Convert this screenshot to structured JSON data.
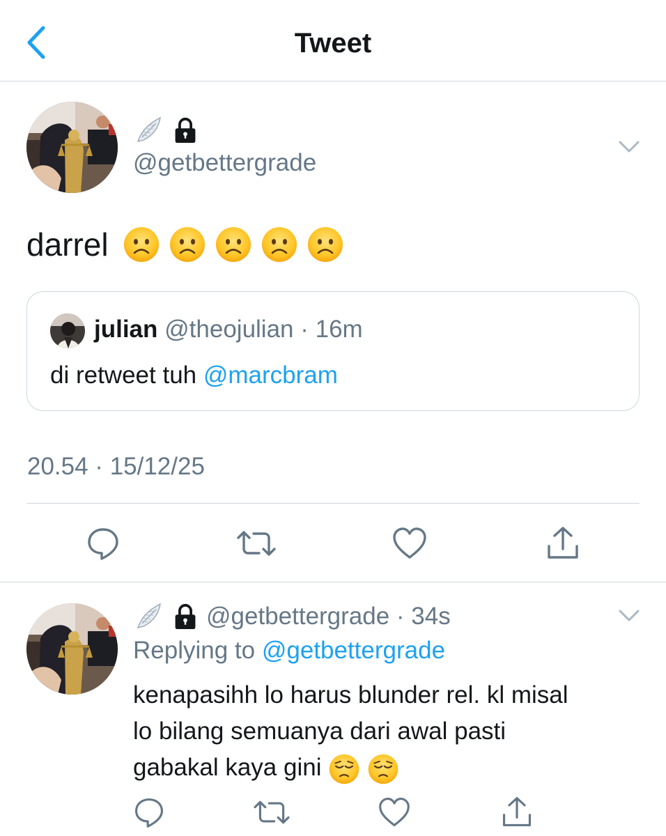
{
  "header": {
    "title": "Tweet"
  },
  "tweet": {
    "handle": "@getbettergrade",
    "text": "darrel",
    "sad_emoji_count": 5,
    "timestamp": "20.54 · 15/12/25",
    "quote": {
      "name": "julian",
      "meta": "@theojulian · 16m",
      "text_prefix": "di retweet tuh ",
      "mention": "@marcbram"
    }
  },
  "reply": {
    "handle_time": "@getbettergrade · 34s",
    "replying_label": "Replying to",
    "replying_to": "@getbettergrade",
    "lines": [
      "kenapasihh lo harus blunder rel. kl misal",
      "lo bilang semuanya dari awal pasti",
      "gabakal kaya gini"
    ]
  },
  "colors": {
    "accent": "#1da1f2",
    "muted": "#657786",
    "text": "#14171a",
    "border": "#ccd6dd"
  },
  "icons": {
    "back": "chevron-left-icon",
    "menu": "chevron-down-icon",
    "badge_wing": "wing-emoji-icon",
    "lock": "lock-icon",
    "reply": "comment-icon",
    "retweet": "retweet-icon",
    "like": "heart-icon",
    "share": "share-icon"
  }
}
